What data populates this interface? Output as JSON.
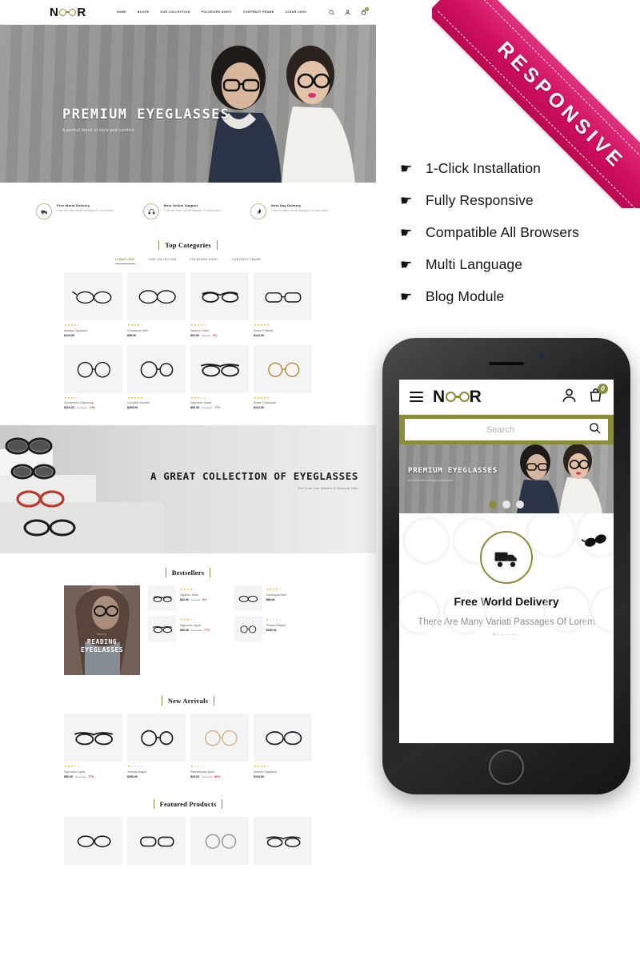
{
  "brand": {
    "name": "NOOR",
    "accent": "#8a8d3c",
    "ribbon_color": "#cf0e5f"
  },
  "desktop": {
    "nav": [
      {
        "label": "HOME"
      },
      {
        "label": "BLOGS"
      },
      {
        "label": "OUR COLLECTION"
      },
      {
        "label": "POLARIZED NIGHT"
      },
      {
        "label": "CONTRAST FRAME"
      },
      {
        "label": "CLEAR LENS"
      }
    ],
    "header_icons": [
      {
        "name": "search-icon"
      },
      {
        "name": "account-icon"
      },
      {
        "name": "cart-icon",
        "badge": "0"
      }
    ],
    "hero": {
      "title": "PREMIUM EYEGLASSES",
      "subtitle": "A perfect blend of style and comfort."
    },
    "services": [
      {
        "icon": "truck-icon",
        "title": "Free World Delivery",
        "desc": "There Are Many Variati Passages Of Lorem Ipsum."
      },
      {
        "icon": "headset-icon",
        "title": "Best Online Support",
        "desc": "There Are Many Variati Passages Of Lorem Ipsum."
      },
      {
        "icon": "rocket-icon",
        "title": "Next Day Delivery",
        "desc": "There Are Many Variati Passages Of Lorem Ipsum."
      }
    ],
    "top_categories": {
      "heading": "Top Categories",
      "tabs": [
        {
          "label": "CLEAR LENS",
          "active": true
        },
        {
          "label": "OUR COLLECTION",
          "active": false
        },
        {
          "label": "POLARIZED NIGHT",
          "active": false
        },
        {
          "label": "CONTRAST FRAME",
          "active": false
        }
      ],
      "products": [
        {
          "name": "Aenean Dignissim",
          "price": "$123.00",
          "old": "",
          "off": "",
          "rating": 4
        },
        {
          "name": "Consequat Nibh",
          "price": "$98.00",
          "old": "",
          "off": "",
          "rating": 4
        },
        {
          "name": "Dapibus Tortor",
          "price": "$62.00",
          "old": "$82.00",
          "off": "6%",
          "rating": 4
        },
        {
          "name": "Donec Pulvinar",
          "price": "$122.00",
          "old": "",
          "off": "",
          "rating": 5
        },
        {
          "name": "Consectetur Adipiscing",
          "price": "$110.20",
          "old": "$122.00",
          "off": "10%",
          "rating": 3
        },
        {
          "name": "Convallis Laoreet",
          "price": "$254.00",
          "old": "",
          "off": "",
          "rating": 5
        },
        {
          "name": "Dignissim Ligula",
          "price": "$50.30",
          "old": "$205.00",
          "off": "77%",
          "rating": 3
        },
        {
          "name": "Mollis Consequat",
          "price": "$122.00",
          "old": "",
          "off": "",
          "rating": 5
        }
      ]
    },
    "banner": {
      "title": "A GREAT COLLECTION OF EYEGLASSES",
      "subtitle": "Get From Your Wishlist & Discount Offer"
    },
    "bestsellers": {
      "heading": "Bestsellers",
      "promo": {
        "eyebrow": "SHOP",
        "title_line1": "READING",
        "title_line2": "EYEGLASSES"
      },
      "products": [
        {
          "name": "Dapibus Tortor",
          "price": "$62.00",
          "old": "$82.00",
          "off": "6%",
          "rating": 4
        },
        {
          "name": "Consequat Nibh",
          "price": "$98.00",
          "old": "",
          "off": "",
          "rating": 4
        },
        {
          "name": "Dignissim Ligula",
          "price": "$50.30",
          "old": "$205.00",
          "off": "77%",
          "rating": 3
        },
        {
          "name": "Tempus Magna",
          "price": "$290.00",
          "old": "",
          "off": "",
          "rating": 1
        }
      ]
    },
    "new_arrivals": {
      "heading": "New Arrivals",
      "products": [
        {
          "name": "Dignissim Ligula",
          "price": "$50.30",
          "old": "$205.00",
          "off": "77%",
          "rating": 3
        },
        {
          "name": "Tempus Magna",
          "price": "$290.00",
          "old": "",
          "off": "",
          "rating": 1
        },
        {
          "name": "Pellentesque Dolor",
          "price": "$29.00",
          "old": "$202.00",
          "off": "86%",
          "rating": 1
        },
        {
          "name": "Aenean Dignissim",
          "price": "$123.00",
          "old": "",
          "off": "",
          "rating": 4
        }
      ]
    },
    "featured": {
      "heading": "Featured Products",
      "products": [
        {
          "name": "",
          "price": "",
          "old": "",
          "off": "",
          "rating": 0
        },
        {
          "name": "",
          "price": "",
          "old": "",
          "off": "",
          "rating": 0
        },
        {
          "name": "",
          "price": "",
          "old": "",
          "off": "",
          "rating": 0
        },
        {
          "name": "",
          "price": "",
          "old": "",
          "off": "",
          "rating": 0
        }
      ]
    }
  },
  "ribbon": {
    "label": "RESPONSIVE"
  },
  "features": [
    {
      "icon": "thumbs-up-icon",
      "label": "1-Click Installation"
    },
    {
      "icon": "thumbs-up-icon",
      "label": "Fully Responsive"
    },
    {
      "icon": "thumbs-up-icon",
      "label": "Compatible All Browsers"
    },
    {
      "icon": "thumbs-up-icon",
      "label": "Multi Language"
    },
    {
      "icon": "thumbs-up-icon",
      "label": "Blog Module"
    }
  ],
  "mobile": {
    "logo": "NOOR",
    "cart_badge": "0",
    "search_placeholder": "Search",
    "hero": {
      "title": "PREMIUM EYEGLASSES",
      "subtitle": "A perfect blend of style and comfort."
    },
    "slider_dots": 3,
    "active_dot": 1,
    "service": {
      "icon": "truck-icon",
      "title": "Free World Delivery",
      "desc": "There Are Many Variati Passages Of Lorem Ipsum."
    }
  }
}
